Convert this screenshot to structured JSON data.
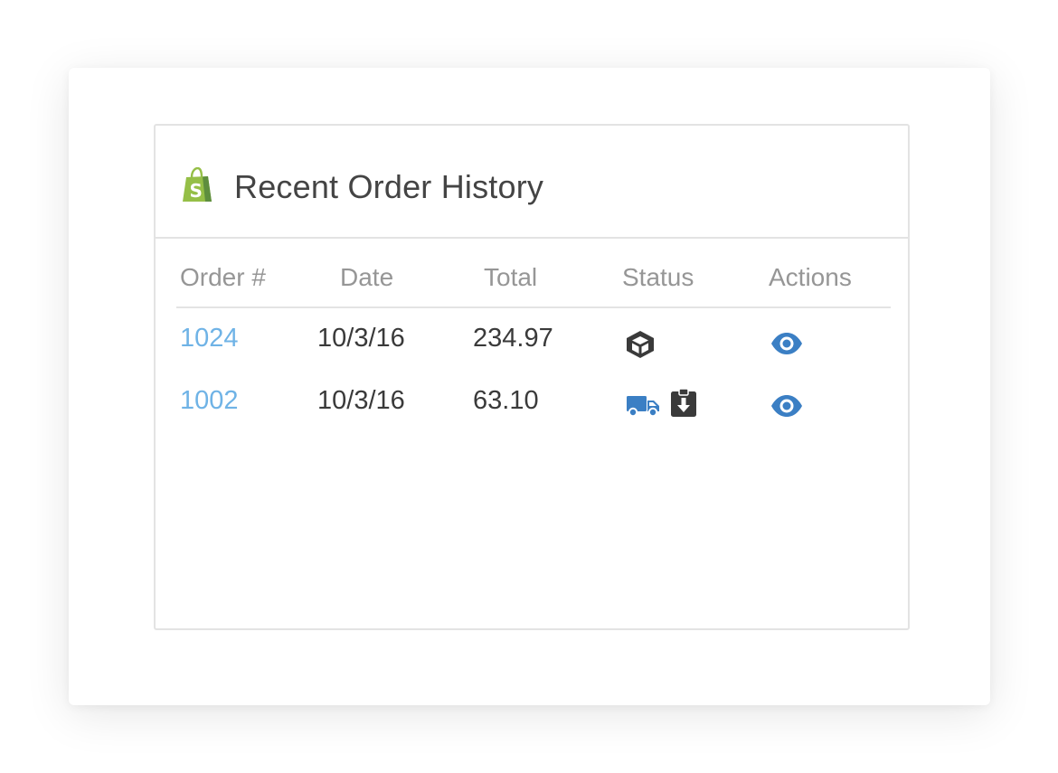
{
  "widget": {
    "title": "Recent Order History",
    "logo_icon": "shopify-bag-icon",
    "brand_color": "#95bf47"
  },
  "table": {
    "columns": [
      "Order #",
      "Date",
      "Total",
      "Status",
      "Actions"
    ],
    "rows": [
      {
        "order": "1024",
        "date": "10/3/16",
        "total": "234.97",
        "status_icons": [
          "package-icon"
        ],
        "action_icon": "eye-icon"
      },
      {
        "order": "1002",
        "date": "10/3/16",
        "total": "63.10",
        "status_icons": [
          "truck-icon",
          "clipboard-download-icon"
        ],
        "action_icon": "eye-icon"
      }
    ]
  },
  "colors": {
    "link": "#6fb3e6",
    "accent_blue": "#3b7fc4",
    "icon_dark": "#3a3a3a",
    "header_text": "#969696",
    "border": "#e3e3e3"
  }
}
